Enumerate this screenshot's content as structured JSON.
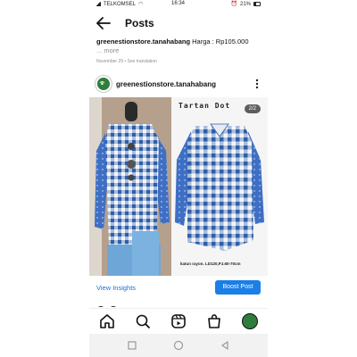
{
  "status_bar": {
    "carrier": "TELKOMSEL",
    "time": "16:34",
    "battery": "21%"
  },
  "header": {
    "title": "Posts"
  },
  "caption": {
    "username": "greenestionstore.tanahabang",
    "text": " Harga : Rp105.000",
    "more": "... more"
  },
  "date_line": "November 29 • See translation",
  "post": {
    "username": "greenestionstore.tanahabang",
    "slide_counter": "2/2",
    "overlay_title": "Tartan Dot",
    "overlay_footer": "katun rayon. LD120,PJ.60-70cm"
  },
  "actions": {
    "view_insights": "View Insights",
    "boost_post": "Boost Post"
  },
  "bottom_nav": {
    "items": [
      "home-icon",
      "search-icon",
      "reels-icon",
      "shop-icon",
      "profile-avatar"
    ]
  },
  "android_nav": {
    "items": [
      "recents-square-icon",
      "home-circle-icon",
      "back-triangle-icon"
    ]
  },
  "colors": {
    "accent": "#1a7fe6",
    "link": "#1f6fd6",
    "gingham_blue": "#2f5fa8"
  }
}
